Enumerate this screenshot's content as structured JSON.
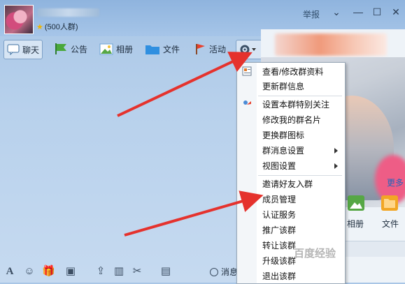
{
  "header": {
    "member_count": "(500人群)",
    "report": "举报",
    "window_controls": [
      "chevron-down-icon",
      "minimize-icon",
      "maximize-icon",
      "close-icon"
    ]
  },
  "toolbar": {
    "items": [
      {
        "label": "聊天",
        "icon": "chat-icon"
      },
      {
        "label": "公告",
        "icon": "flag-icon"
      },
      {
        "label": "相册",
        "icon": "photo-icon"
      },
      {
        "label": "文件",
        "icon": "folder-icon"
      },
      {
        "label": "活动",
        "icon": "activity-flag-icon"
      }
    ],
    "settings_icon": "gear-icon"
  },
  "menu": {
    "items": [
      {
        "label": "查看/修改群资料",
        "icon": "profile-icon"
      },
      {
        "label": "更新群信息"
      },
      {
        "label": "设置本群特别关注",
        "icon": "follow-icon"
      },
      {
        "label": "修改我的群名片"
      },
      {
        "label": "更换群图标"
      },
      {
        "label": "群消息设置",
        "submenu": true
      },
      {
        "label": "视图设置",
        "submenu": true
      },
      {
        "label": "邀请好友入群"
      },
      {
        "label": "成员管理"
      },
      {
        "label": "认证服务"
      },
      {
        "label": "推广该群"
      },
      {
        "label": "转让该群"
      },
      {
        "label": "升级该群"
      },
      {
        "label": "退出该群"
      }
    ]
  },
  "right_panel": {
    "more": "更多",
    "apps": [
      {
        "label": "相册",
        "icon": "album-icon"
      },
      {
        "label": "文件",
        "icon": "file-icon"
      }
    ]
  },
  "bottom_bar": {
    "message_record": "消息"
  },
  "watermark": "百度经验",
  "colors": {
    "accent": "#e5322d",
    "toolbar_active": "#d7e5f4"
  }
}
